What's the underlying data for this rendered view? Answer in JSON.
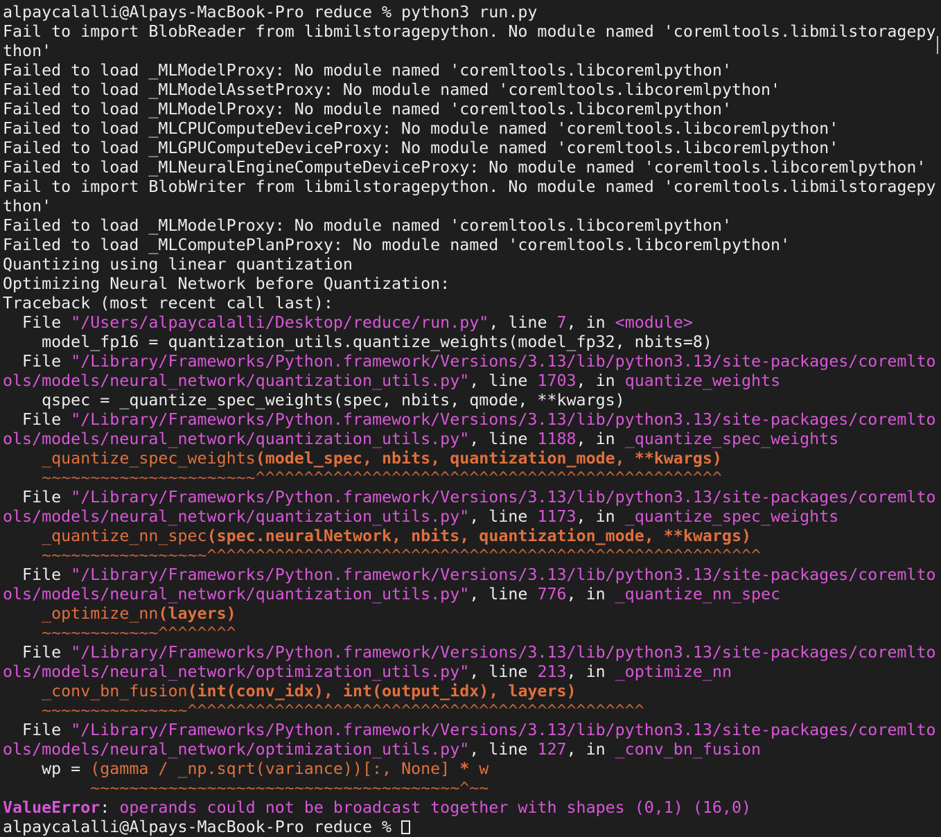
{
  "terminal": {
    "lines": [
      [
        {
          "t": "alpaycalalli@Alpays-MacBook-Pro reduce % python3 run.py"
        }
      ],
      [
        {
          "t": "Fail to import BlobReader from libmilstoragepython. No module named 'coremltools.libmilstoragepy"
        }
      ],
      [
        {
          "t": "thon'"
        }
      ],
      [
        {
          "t": "Failed to load _MLModelProxy: No module named 'coremltools.libcoremlpython'"
        }
      ],
      [
        {
          "t": "Failed to load _MLModelAssetProxy: No module named 'coremltools.libcoremlpython'"
        }
      ],
      [
        {
          "t": "Failed to load _MLModelProxy: No module named 'coremltools.libcoremlpython'"
        }
      ],
      [
        {
          "t": "Failed to load _MLCPUComputeDeviceProxy: No module named 'coremltools.libcoremlpython'"
        }
      ],
      [
        {
          "t": "Failed to load _MLGPUComputeDeviceProxy: No module named 'coremltools.libcoremlpython'"
        }
      ],
      [
        {
          "t": "Failed to load _MLNeuralEngineComputeDeviceProxy: No module named 'coremltools.libcoremlpython'"
        }
      ],
      [
        {
          "t": "Fail to import BlobWriter from libmilstoragepython. No module named 'coremltools.libmilstoragepy"
        }
      ],
      [
        {
          "t": "thon'"
        }
      ],
      [
        {
          "t": "Failed to load _MLModelProxy: No module named 'coremltools.libcoremlpython'"
        }
      ],
      [
        {
          "t": "Failed to load _MLComputePlanProxy: No module named 'coremltools.libcoremlpython'"
        }
      ],
      [
        {
          "t": "Quantizing using linear quantization"
        }
      ],
      [
        {
          "t": "Optimizing Neural Network before Quantization:"
        }
      ],
      [
        {
          "t": "Traceback (most recent call last):"
        }
      ],
      [
        {
          "t": "  File "
        },
        {
          "t": "\"/Users/alpaycalalli/Desktop/reduce/run.py\"",
          "c": "p"
        },
        {
          "t": ", line "
        },
        {
          "t": "7",
          "c": "p"
        },
        {
          "t": ", in "
        },
        {
          "t": "<module>",
          "c": "p"
        }
      ],
      [
        {
          "t": "    model_fp16 = quantization_utils.quantize_weights(model_fp32, nbits=8)"
        }
      ],
      [
        {
          "t": "  File "
        },
        {
          "t": "\"/Library/Frameworks/Python.framework/Versions/3.13/lib/python3.13/site-packages/coremlto",
          "c": "p"
        }
      ],
      [
        {
          "t": "ols/models/neural_network/quantization_utils.py\"",
          "c": "p"
        },
        {
          "t": ", line "
        },
        {
          "t": "1703",
          "c": "p"
        },
        {
          "t": ", in "
        },
        {
          "t": "quantize_weights",
          "c": "p"
        }
      ],
      [
        {
          "t": "    qspec = _quantize_spec_weights(spec, nbits, qmode, **kwargs)"
        }
      ],
      [
        {
          "t": "  File "
        },
        {
          "t": "\"/Library/Frameworks/Python.framework/Versions/3.13/lib/python3.13/site-packages/coremlto",
          "c": "p"
        }
      ],
      [
        {
          "t": "ols/models/neural_network/quantization_utils.py\"",
          "c": "p"
        },
        {
          "t": ", line "
        },
        {
          "t": "1188",
          "c": "p"
        },
        {
          "t": ", in "
        },
        {
          "t": "_quantize_spec_weights",
          "c": "p"
        }
      ],
      [
        {
          "t": "    "
        },
        {
          "t": "_quantize_spec_weights",
          "c": "o"
        },
        {
          "t": "(model_spec, nbits, quantization_mode, **kwargs)",
          "c": "ob"
        }
      ],
      [
        {
          "t": "    "
        },
        {
          "t": "~~~~~~~~~~~~~~~~~~~~~~^^^^^^^^^^^^^^^^^^^^^^^^^^^^^^^^^^^^^^^^^^^^^^^^",
          "c": "r"
        }
      ],
      [
        {
          "t": "  File "
        },
        {
          "t": "\"/Library/Frameworks/Python.framework/Versions/3.13/lib/python3.13/site-packages/coremlto",
          "c": "p"
        }
      ],
      [
        {
          "t": "ols/models/neural_network/quantization_utils.py\"",
          "c": "p"
        },
        {
          "t": ", line "
        },
        {
          "t": "1173",
          "c": "p"
        },
        {
          "t": ", in "
        },
        {
          "t": "_quantize_spec_weights",
          "c": "p"
        }
      ],
      [
        {
          "t": "    "
        },
        {
          "t": "_quantize_nn_spec",
          "c": "o"
        },
        {
          "t": "(spec.neuralNetwork, nbits, quantization_mode, **kwargs)",
          "c": "ob"
        }
      ],
      [
        {
          "t": "    "
        },
        {
          "t": "~~~~~~~~~~~~~~~~~^^^^^^^^^^^^^^^^^^^^^^^^^^^^^^^^^^^^^^^^^^^^^^^^^^^^^^^^^",
          "c": "r"
        }
      ],
      [
        {
          "t": "  File "
        },
        {
          "t": "\"/Library/Frameworks/Python.framework/Versions/3.13/lib/python3.13/site-packages/coremlto",
          "c": "p"
        }
      ],
      [
        {
          "t": "ols/models/neural_network/quantization_utils.py\"",
          "c": "p"
        },
        {
          "t": ", line "
        },
        {
          "t": "776",
          "c": "p"
        },
        {
          "t": ", in "
        },
        {
          "t": "_quantize_nn_spec",
          "c": "p"
        }
      ],
      [
        {
          "t": "    "
        },
        {
          "t": "_optimize_nn",
          "c": "o"
        },
        {
          "t": "(layers)",
          "c": "ob"
        }
      ],
      [
        {
          "t": "    "
        },
        {
          "t": "~~~~~~~~~~~~^^^^^^^^",
          "c": "r"
        }
      ],
      [
        {
          "t": "  File "
        },
        {
          "t": "\"/Library/Frameworks/Python.framework/Versions/3.13/lib/python3.13/site-packages/coremlto",
          "c": "p"
        }
      ],
      [
        {
          "t": "ols/models/neural_network/optimization_utils.py\"",
          "c": "p"
        },
        {
          "t": ", line "
        },
        {
          "t": "213",
          "c": "p"
        },
        {
          "t": ", in "
        },
        {
          "t": "_optimize_nn",
          "c": "p"
        }
      ],
      [
        {
          "t": "    "
        },
        {
          "t": "_conv_bn_fusion",
          "c": "o"
        },
        {
          "t": "(int(conv_idx), int(output_idx), layers)",
          "c": "ob"
        }
      ],
      [
        {
          "t": "    "
        },
        {
          "t": "~~~~~~~~~~~~~~~^^^^^^^^^^^^^^^^^^^^^^^^^^^^^^^^^^^^^^^^^^^^^^^",
          "c": "r"
        }
      ],
      [
        {
          "t": "  File "
        },
        {
          "t": "\"/Library/Frameworks/Python.framework/Versions/3.13/lib/python3.13/site-packages/coremlto",
          "c": "p"
        }
      ],
      [
        {
          "t": "ols/models/neural_network/optimization_utils.py\"",
          "c": "p"
        },
        {
          "t": ", line "
        },
        {
          "t": "127",
          "c": "p"
        },
        {
          "t": ", in "
        },
        {
          "t": "_conv_bn_fusion",
          "c": "p"
        }
      ],
      [
        {
          "t": "    wp = "
        },
        {
          "t": "(gamma / _np.sqrt(variance))[:, None]",
          "c": "o"
        },
        {
          "t": " "
        },
        {
          "t": "*",
          "c": "ob"
        },
        {
          "t": " "
        },
        {
          "t": "w",
          "c": "o"
        }
      ],
      [
        {
          "t": "         "
        },
        {
          "t": "~~~~~~~~~~~~~~~~~~~~~~~~~~~~~~~~~~~~~~^~~",
          "c": "r"
        }
      ],
      [
        {
          "t": "ValueError",
          "c": "err"
        },
        {
          "t": ": "
        },
        {
          "t": "operands could not be broadcast together with shapes (0,1) (16,0)",
          "c": "p"
        }
      ],
      [
        {
          "t": "alpaycalalli@Alpays-MacBook-Pro reduce % "
        },
        {
          "cursor": true
        }
      ]
    ]
  }
}
